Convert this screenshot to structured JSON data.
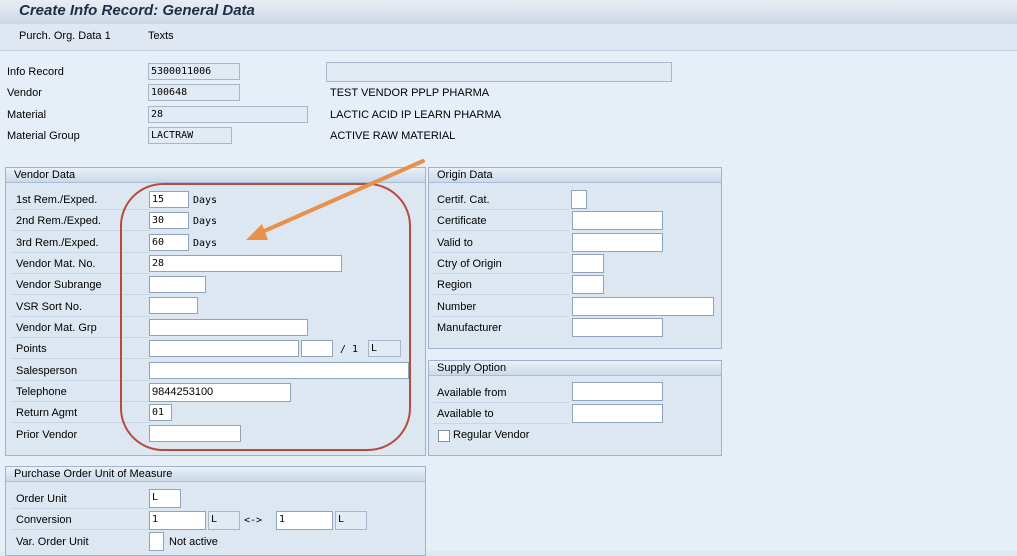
{
  "window": {
    "title": "Create Info Record: General Data"
  },
  "toolbar": {
    "btn1": "Purch. Org. Data 1",
    "btn2": "Texts"
  },
  "header": {
    "info_record_label": "Info Record",
    "info_record_value": "5300011006",
    "vendor_label": "Vendor",
    "vendor_value": "100648",
    "vendor_name": "TEST VENDOR PPLP PHARMA",
    "material_label": "Material",
    "material_value": "28",
    "material_desc": "LACTIC ACID IP LEARN PHARMA",
    "matgroup_label": "Material Group",
    "matgroup_value": "LACTRAW",
    "matgroup_desc": "ACTIVE RAW MATERIAL"
  },
  "vendor_data": {
    "title": "Vendor Data",
    "rem1_label": "1st Rem./Exped.",
    "rem1_value": "15",
    "rem2_label": "2nd Rem./Exped.",
    "rem2_value": "30",
    "rem3_label": "3rd Rem./Exped.",
    "rem3_value": "60",
    "days": "Days",
    "vmatno_label": "Vendor Mat. No.",
    "vmatno_value": "28",
    "subrange_label": "Vendor Subrange",
    "vsr_label": "VSR Sort No.",
    "vmatgrp_label": "Vendor Mat. Grp",
    "points_label": "Points",
    "points_sep": "/ 1",
    "points_unit": "L",
    "salesperson_label": "Salesperson",
    "telephone_label": "Telephone",
    "telephone_value": "9844253100",
    "return_label": "Return Agmt",
    "return_value": "01",
    "prior_label": "Prior Vendor"
  },
  "origin_data": {
    "title": "Origin Data",
    "certcat_label": "Certif. Cat.",
    "cert_label": "Certificate",
    "valid_label": "Valid to",
    "ctry_label": "Ctry of Origin",
    "region_label": "Region",
    "number_label": "Number",
    "manuf_label": "Manufacturer"
  },
  "supply": {
    "title": "Supply Option",
    "from_label": "Available from",
    "to_label": "Available to",
    "regular_label": "Regular Vendor"
  },
  "po_unit": {
    "title": "Purchase Order Unit of Measure",
    "order_unit_label": "Order Unit",
    "order_unit_value": "L",
    "conversion_label": "Conversion",
    "conv_left": "1",
    "conv_left_unit": "L",
    "conv_arrow": "<->",
    "conv_right": "1",
    "conv_right_unit": "L",
    "var_label": "Var. Order Unit",
    "var_status": "Not active"
  },
  "annotation_colors": {
    "arrow": "#e8914a",
    "ellipse": "#b84a3e"
  }
}
